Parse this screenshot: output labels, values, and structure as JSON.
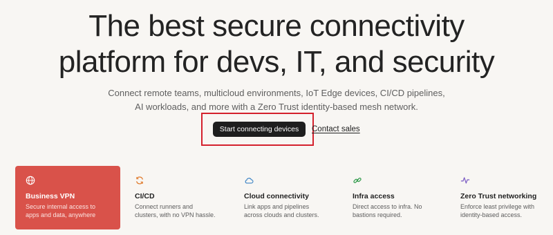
{
  "hero": {
    "title_line1": "The best secure connectivity",
    "title_line2": "platform for devs, IT, and security",
    "subtitle_line1": "Connect remote teams, multicloud environments, IoT Edge devices, CI/CD pipelines,",
    "subtitle_line2": "AI workloads, and more with a Zero Trust identity-based mesh network."
  },
  "cta": {
    "primary_label": "Start connecting devices",
    "secondary_label": "Contact sales"
  },
  "use_cases": [
    {
      "title": "Business VPN",
      "desc_line1": "Secure internal access to",
      "desc_line2": "apps and data, anywhere",
      "icon": "globe-icon",
      "active": true
    },
    {
      "title": "CI/CD",
      "desc_line1": "Connect runners and",
      "desc_line2": "clusters, with no VPN hassle.",
      "icon": "refresh-icon"
    },
    {
      "title": "Cloud connectivity",
      "desc_line1": "Link apps and pipelines",
      "desc_line2": "across clouds and clusters.",
      "icon": "cloud-icon"
    },
    {
      "title": "Infra access",
      "desc_line1": "Direct access to infra. No",
      "desc_line2": "bastions required.",
      "icon": "link-icon"
    },
    {
      "title": "Zero Trust networking",
      "desc_line1": "Enforce least privilege with",
      "desc_line2": "identity-based access.",
      "icon": "pulse-icon"
    }
  ],
  "colors": {
    "background": "#f8f6f3",
    "active_card": "#d9524a",
    "highlight_border": "#d4202c",
    "icon_cicd": "#e07a2b",
    "icon_cloud": "#3b82c4",
    "icon_infra": "#2f9a4a",
    "icon_zero_trust": "#7b5cc4"
  }
}
